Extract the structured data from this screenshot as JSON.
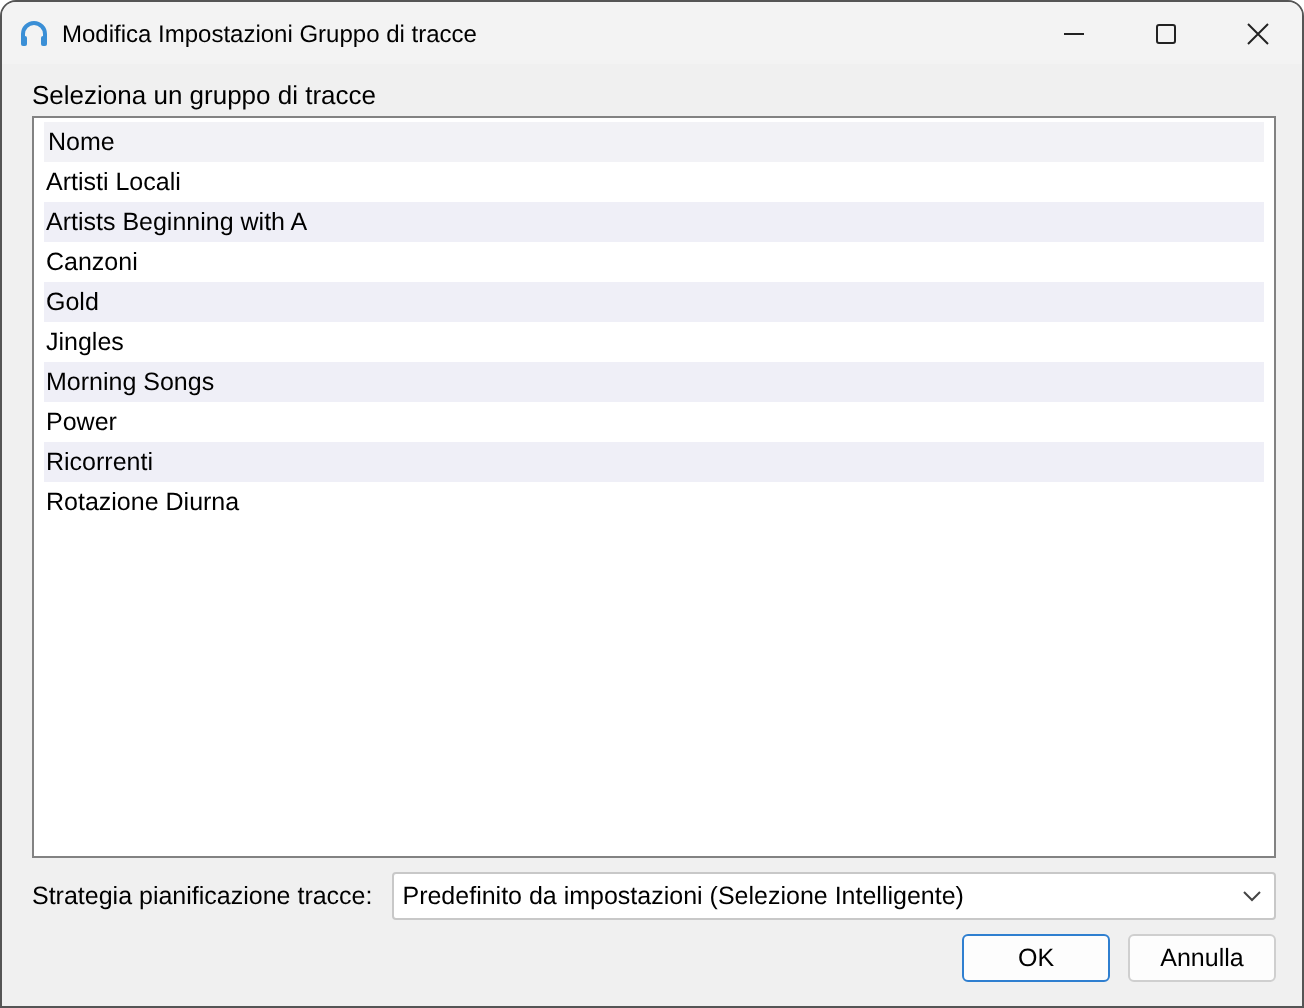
{
  "window": {
    "title": "Modifica Impostazioni Gruppo di tracce"
  },
  "list_label": "Seleziona un gruppo di tracce",
  "list": {
    "column": "Nome",
    "rows": [
      "Artisti Locali",
      "Artists Beginning with A",
      "Canzoni",
      "Gold",
      "Jingles",
      "Morning Songs",
      "Power",
      "Ricorrenti",
      "Rotazione Diurna"
    ]
  },
  "strategy": {
    "label": "Strategia pianificazione tracce:",
    "value": "Predefinito da impostazioni (Selezione Intelligente)"
  },
  "buttons": [
    {
      "label": "OK",
      "kind": "default"
    },
    {
      "label": "Annulla",
      "kind": "normal"
    }
  ]
}
